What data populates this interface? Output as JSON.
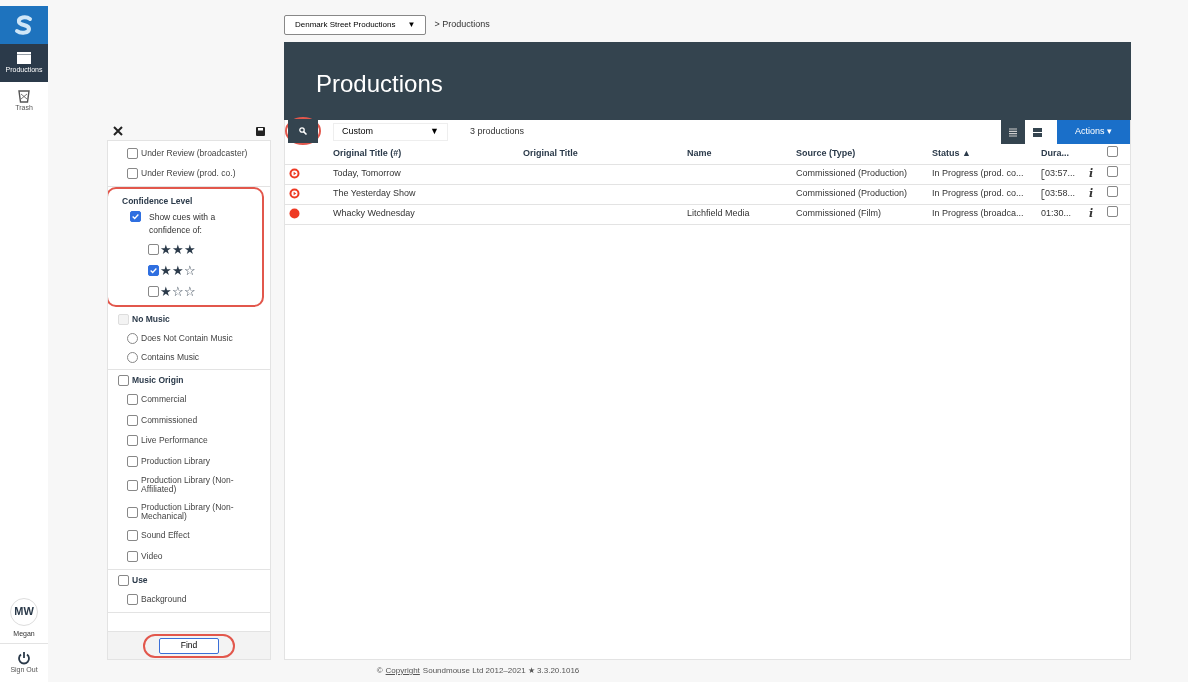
{
  "nav": {
    "items": [
      {
        "label": "Productions",
        "selected": true,
        "kind": "clapper"
      },
      {
        "label": "Trash",
        "selected": false,
        "kind": "trash"
      }
    ],
    "user": {
      "initials": "MW",
      "name": "Megan"
    },
    "sign_out": "Sign Out"
  },
  "filter": {
    "groups": [
      {
        "items": [
          {
            "label": "Under Review (broadcaster)",
            "checked": false
          },
          {
            "label": "Under Review (prod. co.)",
            "checked": false
          }
        ]
      },
      {
        "title": "Confidence Level",
        "kind": "confidence",
        "highlighted": true,
        "option": {
          "label": "Show cues with a confidence of:",
          "checked": true
        },
        "levels": [
          {
            "stars": 3,
            "checked": false
          },
          {
            "stars": 2,
            "checked": true
          },
          {
            "stars": 1,
            "checked": false
          }
        ]
      },
      {
        "title": "No Music",
        "title_checked": false,
        "disabled": true,
        "kind": "radio",
        "items": [
          {
            "label": "Does Not Contain Music",
            "selected": false
          },
          {
            "label": "Contains Music",
            "selected": false
          }
        ]
      },
      {
        "title": "Music Origin",
        "title_checked": false,
        "items": [
          {
            "label": "Commercial",
            "checked": false
          },
          {
            "label": "Commissioned",
            "checked": false
          },
          {
            "label": "Live Performance",
            "checked": false
          },
          {
            "label": "Production Library",
            "checked": false
          },
          {
            "label": "Production Library (Non-Affiliated)",
            "checked": false
          },
          {
            "label": "Production Library (Non-Mechanical)",
            "checked": false
          },
          {
            "label": "Sound Effect",
            "checked": false
          },
          {
            "label": "Video",
            "checked": false
          }
        ]
      },
      {
        "title": "Use",
        "title_checked": false,
        "items": [
          {
            "label": "Background",
            "checked": false
          }
        ]
      }
    ],
    "find": "Find"
  },
  "breadcrumb": {
    "company": "Denmark Street Productions",
    "dropdown": "▼",
    "path": "> Productions"
  },
  "page_title": "Productions",
  "toolbar": {
    "view": "Custom",
    "dropdown": "▼",
    "count": "3 productions",
    "views": [
      {
        "kind": "list",
        "selected": false
      },
      {
        "kind": "cards",
        "selected": true
      }
    ],
    "actions": "Actions ▾"
  },
  "table": {
    "columns": [
      "Original Title (#)",
      "Original Title",
      "Name",
      "Source (Type)",
      "Status ▲",
      "Dura..."
    ],
    "rows": [
      {
        "kind": "play",
        "cells": [
          "Today, Tomorrow",
          "",
          "",
          "Commissioned (Production)",
          "In Progress (prod. co...",
          "03:57..."
        ],
        "bracket": true,
        "checked": false,
        "info": "i"
      },
      {
        "kind": "play",
        "cells": [
          "The Yesterday Show",
          "",
          "",
          "Commissioned (Production)",
          "In Progress (prod. co...",
          "03:58..."
        ],
        "bracket": true,
        "checked": false,
        "info": "i"
      },
      {
        "kind": "dot",
        "cells": [
          "Whacky Wednesday",
          "",
          "Litchfield Media",
          "Commissioned (Film)",
          "In Progress (broadca...",
          "01:30..."
        ],
        "bracket": false,
        "checked": false,
        "info": "i"
      }
    ],
    "all_checked": false
  },
  "footer": {
    "prefix": "©",
    "link": "Copyright",
    "text": "Soundmouse Ltd 2012–2021 ★ 3.3.20.1016"
  }
}
